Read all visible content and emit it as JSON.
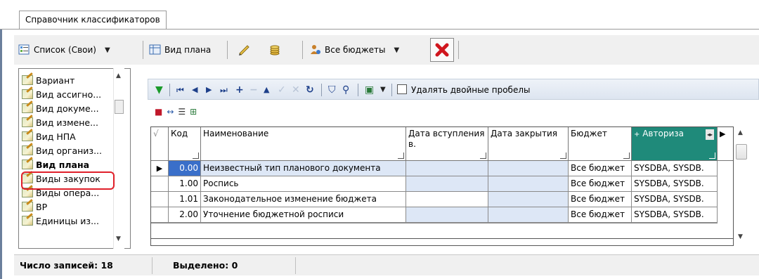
{
  "tab": {
    "label": "Справочник классификаторов"
  },
  "toolbar": {
    "list_label": "Список (Свои)",
    "view_plan_label": "Вид плана",
    "all_budgets_label": "Все бюджеты"
  },
  "left_list": {
    "items": [
      {
        "label": "Вариант"
      },
      {
        "label": "Вид ассигно..."
      },
      {
        "label": "Вид докуме..."
      },
      {
        "label": "Вид измене..."
      },
      {
        "label": "Вид НПА"
      },
      {
        "label": "Вид организ..."
      },
      {
        "label": "Вид плана"
      },
      {
        "label": "Виды закупок"
      },
      {
        "label": "Виды опера..."
      },
      {
        "label": "ВР"
      },
      {
        "label": "Единицы из..."
      }
    ],
    "selected_index": 6
  },
  "grid_toolbar": {
    "remove_double_spaces_label": "Удалять двойные пробелы",
    "remove_double_spaces_checked": false
  },
  "grid": {
    "columns": [
      {
        "label": "Код"
      },
      {
        "label": "Наименование"
      },
      {
        "label": "Дата вступления в."
      },
      {
        "label": "Дата закрытия"
      },
      {
        "label": "Бюджет"
      },
      {
        "label": "Авториза"
      }
    ],
    "rows": [
      {
        "code": "0.00",
        "name": "Неизвестный тип планового документа",
        "start_date": "",
        "close_date": "",
        "budget": "Все бюджет",
        "auth": "SYSDBA, SYSDB."
      },
      {
        "code": "1.00",
        "name": "Роспись",
        "start_date": "",
        "close_date": "",
        "budget": "Все бюджет",
        "auth": "SYSDBA, SYSDB."
      },
      {
        "code": "1.01",
        "name": "Законодательное изменение бюджета",
        "start_date": "",
        "close_date": "",
        "budget": "Все бюджет",
        "auth": "SYSDBA, SYSDB."
      },
      {
        "code": "2.00",
        "name": "Уточнение бюджетной росписи",
        "start_date": "",
        "close_date": "",
        "budget": "Все бюджет",
        "auth": "SYSDBA, SYSDB."
      }
    ]
  },
  "status": {
    "records_label": "Число записей:",
    "records_count": "18",
    "selected_label": "Выделено:",
    "selected_count": "0"
  },
  "colors": {
    "selection_blue": "#3a6fc9",
    "teal_header": "#1f8a7a",
    "highlight_red": "#e0202a"
  }
}
